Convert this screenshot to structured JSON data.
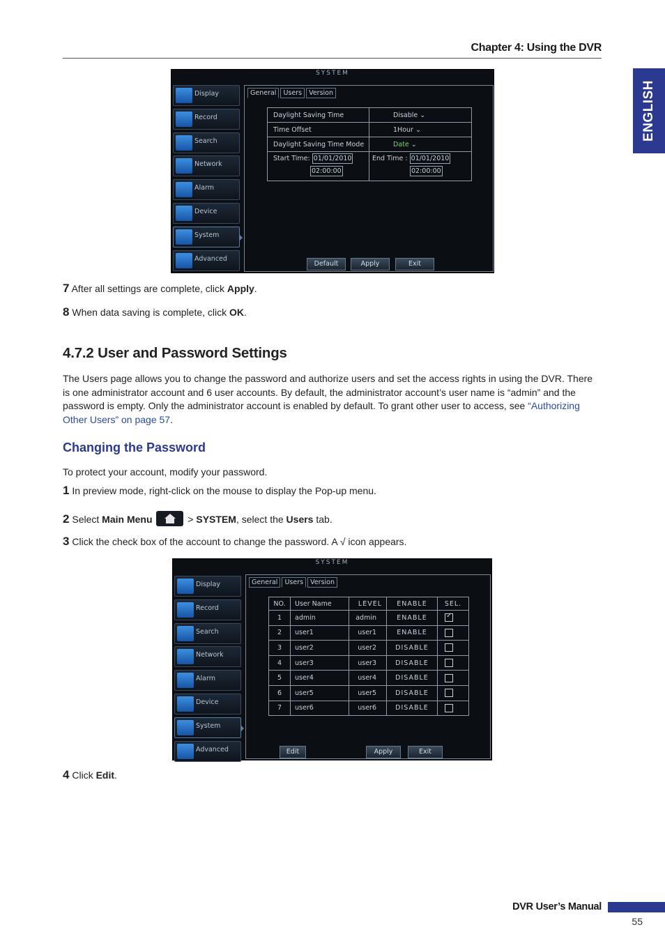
{
  "header": {
    "chapter": "Chapter 4: Using the DVR",
    "side_tab": "ENGLISH"
  },
  "dvr_common": {
    "title": "SYSTEM",
    "menu": [
      "Display",
      "Record",
      "Search",
      "Network",
      "Alarm",
      "Device",
      "System",
      "Advanced"
    ],
    "tabs": [
      "General",
      "Users",
      "Version"
    ]
  },
  "screenshot1": {
    "rows": [
      {
        "label": "Daylight Saving Time",
        "value": "Disable"
      },
      {
        "label": "Time Offset",
        "value": "1Hour"
      },
      {
        "label": "Daylight Saving Time Mode",
        "value": "Date"
      }
    ],
    "start_label": "Start Time:",
    "start_date": "01/01/2010",
    "start_time": "02:00:00",
    "end_label": "End Time :",
    "end_date": "01/01/2010",
    "end_time": "02:00:00",
    "buttons": [
      "Default",
      "Apply",
      "Exit"
    ]
  },
  "steps_a": [
    {
      "num": "7",
      "pre": "After all settings are complete, click ",
      "bold": "Apply",
      "post": "."
    },
    {
      "num": "8",
      "pre": "When data saving is complete, click ",
      "bold": "OK",
      "post": "."
    }
  ],
  "section": {
    "title": "4.7.2 User and Password Settings",
    "para": "The Users page allows you to change the password and authorize users and set the access rights in using the DVR. There is one administrator account and 6 user accounts. By default, the administrator account’s user name is “admin” and the password is empty. Only the administrator account is enabled by default. To grant other user to access, see ",
    "link": "“Authorizing Other Users” on page 57",
    "para_end": "."
  },
  "subsection": {
    "title": "Changing the Password",
    "intro": "To protect your account, modify your password."
  },
  "steps_b": {
    "s1": {
      "num": "1",
      "text": "In preview mode, right-click on the mouse to display the Pop-up menu."
    },
    "s2": {
      "num": "2",
      "pre": "Select ",
      "bold1": "Main Menu",
      "mid": " > ",
      "bold2": "SYSTEM",
      "mid2": ", select the ",
      "bold3": "Users",
      "post": " tab."
    },
    "s3": {
      "num": "3",
      "text": "Click the check box of the account to change the password. A √ icon appears."
    },
    "s4": {
      "num": "4",
      "pre": "Click ",
      "bold": "Edit",
      "post": "."
    }
  },
  "screenshot2": {
    "headers": [
      "NO.",
      "User Name",
      "LEVEL",
      "ENABLE",
      "SEL."
    ],
    "users": [
      {
        "no": "1",
        "name": "admin",
        "level": "admin",
        "enable": "ENABLE",
        "sel": true
      },
      {
        "no": "2",
        "name": "user1",
        "level": "user1",
        "enable": "ENABLE",
        "sel": false
      },
      {
        "no": "3",
        "name": "user2",
        "level": "user2",
        "enable": "DISABLE",
        "sel": false
      },
      {
        "no": "4",
        "name": "user3",
        "level": "user3",
        "enable": "DISABLE",
        "sel": false
      },
      {
        "no": "5",
        "name": "user4",
        "level": "user4",
        "enable": "DISABLE",
        "sel": false
      },
      {
        "no": "6",
        "name": "user5",
        "level": "user5",
        "enable": "DISABLE",
        "sel": false
      },
      {
        "no": "7",
        "name": "user6",
        "level": "user6",
        "enable": "DISABLE",
        "sel": false
      }
    ],
    "buttons": [
      "Edit",
      "Apply",
      "Exit"
    ]
  },
  "footer": {
    "manual": "DVR User’s Manual",
    "page": "55"
  },
  "colors": {
    "accent": "#2b3990",
    "link": "#2b4aa0",
    "dvr_bg": "#0b0f14"
  }
}
